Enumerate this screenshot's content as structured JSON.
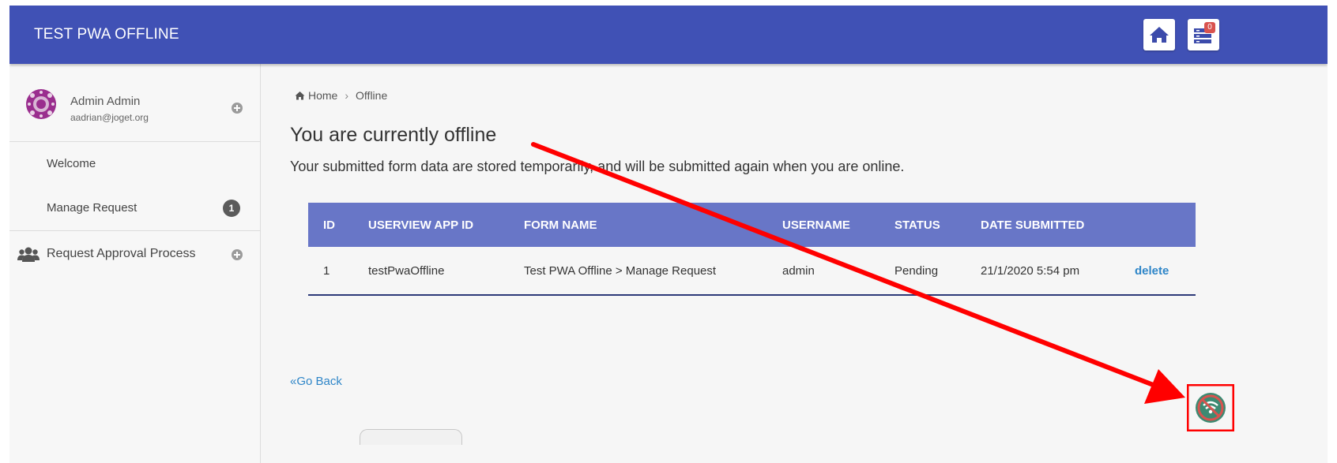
{
  "header": {
    "title": "TEST PWA OFFLINE",
    "home_icon": "home-icon",
    "queue_icon": "sync-queue-icon",
    "queue_count": "0",
    "color": "#4051b5"
  },
  "sidebar": {
    "user": {
      "name": "Admin Admin",
      "email": "aadrian@joget.org",
      "avatar_icon": "avatar-icon"
    },
    "items": [
      {
        "label": "Welcome"
      },
      {
        "label": "Manage Request",
        "badge": "1"
      },
      {
        "label": "Request Approval Process",
        "icon": "users-icon"
      }
    ]
  },
  "breadcrumb": {
    "home": "Home",
    "separator": "›",
    "current": "Offline"
  },
  "main": {
    "title": "You are currently offline",
    "description": "Your submitted form data are stored temporarily, and will be submitted again when you are online.",
    "go_back": "«Go Back"
  },
  "table": {
    "headers": [
      "ID",
      "USERVIEW APP ID",
      "FORM NAME",
      "USERNAME",
      "STATUS",
      "DATE SUBMITTED",
      ""
    ],
    "rows": [
      {
        "id": "1",
        "app_id": "testPwaOffline",
        "form_name": "Test PWA Offline > Manage Request",
        "username": "admin",
        "status": "Pending",
        "date": "21/1/2020 5:54 pm",
        "action": "delete"
      }
    ],
    "header_color": "#6876c7"
  },
  "annotation": {
    "color": "#ff0000",
    "target_icon": "offline-wifi-icon"
  }
}
